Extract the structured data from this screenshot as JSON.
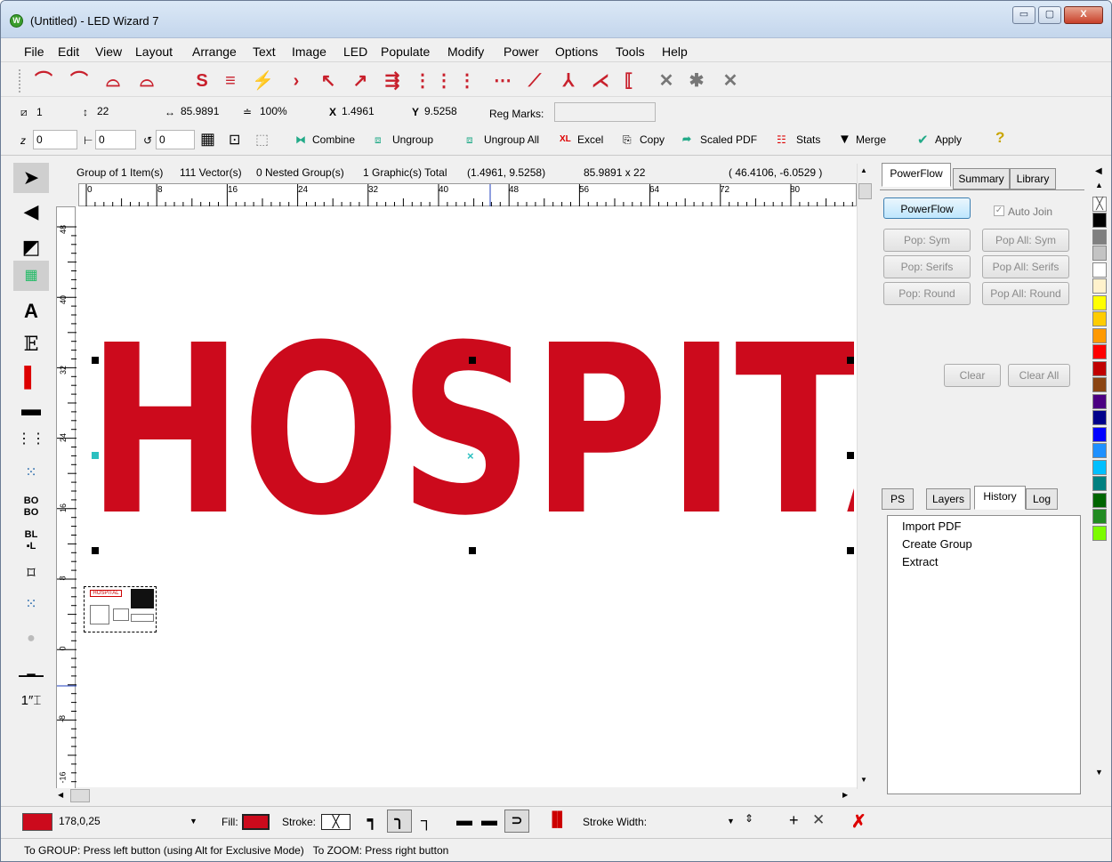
{
  "window": {
    "title": "(Untitled) - LED Wizard 7",
    "app_icon": "W",
    "minimize": "▭",
    "maximize": "▢",
    "close": "X"
  },
  "menu": [
    "File",
    "Edit",
    "View",
    "Layout",
    "Arrange",
    "Text",
    "Image",
    "LED",
    "Populate",
    "Modify",
    "Power",
    "Options",
    "Tools",
    "Help"
  ],
  "toolbar2": {
    "page": "1",
    "height_val": "22",
    "width_val": "85.9891",
    "zoom": "100%",
    "x_label": "X",
    "x_val": "1.4961",
    "y_label": "Y",
    "y_val": "9.5258",
    "reg_marks_label": "Reg Marks:",
    "reg_marks_val": ""
  },
  "toolbar3": {
    "z_val": "0",
    "h_val": "0",
    "rot_val": "0",
    "combine": "Combine",
    "ungroup": "Ungroup",
    "ungroup_all": "Ungroup All",
    "xl_icon": "XL",
    "excel": "Excel",
    "copy": "Copy",
    "scaled_pdf": "Scaled PDF",
    "stats": "Stats",
    "merge": "Merge",
    "apply": "Apply"
  },
  "infobar": {
    "group": "Group of 1 Item(s)",
    "vectors": "111 Vector(s)",
    "nested": "0 Nested Group(s)",
    "graphics": "1 Graphic(s) Total",
    "pos": "(1.4961, 9.5258)",
    "size": "85.9891 x 22",
    "cursor": "( 46.4106,  -6.0529 )"
  },
  "ruler": {
    "h_ticks": [
      "0",
      "8",
      "16",
      "24",
      "32",
      "40",
      "48",
      "56",
      "64",
      "72",
      "80"
    ],
    "v_ticks": [
      "48",
      "40",
      "32",
      "24",
      "16",
      "8",
      "0",
      "-8",
      "-16"
    ]
  },
  "canvas": {
    "text": "HOSPITAL",
    "thumb_text": "HOSPITAL",
    "fill_color": "#cc0a1c"
  },
  "panel": {
    "tabs": [
      "PowerFlow",
      "Summary",
      "Library"
    ],
    "powerflow_button": "PowerFlow",
    "auto_join_label": "Auto Join",
    "pop_sym": "Pop: Sym",
    "pop_all_sym": "Pop All: Sym",
    "pop_serifs": "Pop: Serifs",
    "pop_all_serifs": "Pop All: Serifs",
    "pop_round": "Pop: Round",
    "pop_all_round": "Pop All: Round",
    "clear": "Clear",
    "clear_all": "Clear All",
    "bottom_tabs": [
      "PS",
      "Layers",
      "History",
      "Log"
    ],
    "history": [
      "Import PDF",
      "Create Group",
      "Extract"
    ]
  },
  "palette_colors": [
    "#000000",
    "#7f7f7f",
    "#c3c3c3",
    "#ffffff",
    "#fff2cc",
    "#ffff00",
    "#ffcc00",
    "#ff9900",
    "#ff0000",
    "#c00000",
    "#8b4513",
    "#4b0082",
    "#00008b",
    "#0000ff",
    "#1e90ff",
    "#00bfff",
    "#008080",
    "#006400",
    "#228b22",
    "#7cfc00"
  ],
  "bottombar": {
    "color_value": "178,0,25",
    "fill_label": "Fill:",
    "stroke_label": "Stroke:",
    "stroke_width_label": "Stroke Width:",
    "stroke_width_val": "",
    "color_hex": "#cc0a1c"
  },
  "status": {
    "text": "To GROUP: Press left button (using Alt for Exclusive Mode)   To ZOOM: Press right button"
  }
}
